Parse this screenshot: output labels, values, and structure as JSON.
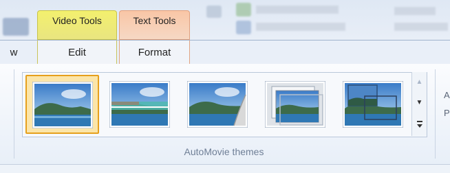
{
  "context_tabs": {
    "video_tools": "Video Tools",
    "text_tools": "Text Tools"
  },
  "tabs": {
    "partial": "w",
    "edit": "Edit",
    "format": "Format"
  },
  "gallery": {
    "group_label": "AutoMovie themes",
    "themes": [
      {
        "icon": "theme-contemporary-icon",
        "selected": true
      },
      {
        "icon": "theme-cinematic-icon",
        "selected": false
      },
      {
        "icon": "theme-fade-icon",
        "selected": false
      },
      {
        "icon": "theme-pan-zoom-icon",
        "selected": false
      },
      {
        "icon": "theme-classic-icon",
        "selected": false
      }
    ],
    "scroll_up_icon": "scroll-up-icon",
    "scroll_down_icon": "scroll-down-icon",
    "more_icon": "gallery-more-icon"
  },
  "right_edge_partial": {
    "top": "A",
    "bottom": "P"
  },
  "colors": {
    "video_tools_tab": "#f3f06e",
    "text_tools_tab": "#f9c6a6",
    "selected_border": "#e6a01c"
  }
}
